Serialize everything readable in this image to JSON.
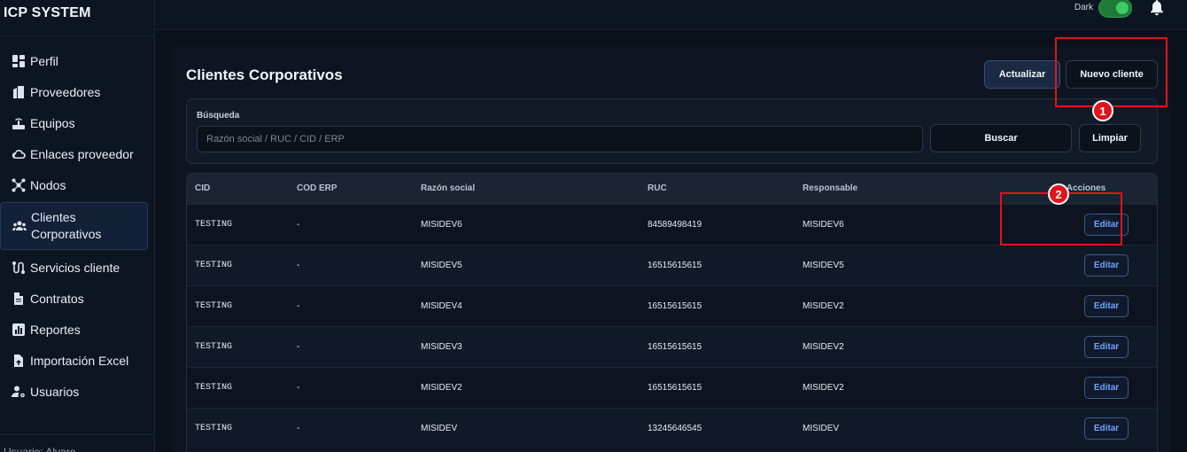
{
  "app": {
    "brand": "ICP SYSTEM"
  },
  "sidebar": {
    "items": [
      {
        "label": "Perfil",
        "icon": "dashboard-icon"
      },
      {
        "label": "Proveedores",
        "icon": "building-icon"
      },
      {
        "label": "Equipos",
        "icon": "router-icon"
      },
      {
        "label": "Enlaces proveedor",
        "icon": "cloud-icon"
      },
      {
        "label": "Nodos",
        "icon": "network-icon"
      },
      {
        "label": "Clientes Corporativos",
        "icon": "users-icon"
      },
      {
        "label": "Servicios cliente",
        "icon": "route-icon"
      },
      {
        "label": "Contratos",
        "icon": "file-icon"
      },
      {
        "label": "Reportes",
        "icon": "chart-icon"
      },
      {
        "label": "Importación Excel",
        "icon": "file-upload-icon"
      },
      {
        "label": "Usuarios",
        "icon": "user-gear-icon"
      }
    ],
    "footer": "Usuario: Alvaro"
  },
  "topbar": {
    "theme_label": "Dark",
    "dark_on": true
  },
  "page": {
    "title": "Clientes Corporativos",
    "update_label": "Actualizar",
    "new_label": "Nuevo cliente"
  },
  "search": {
    "label": "Búsqueda",
    "placeholder": "Razón social / RUC / CID / ERP",
    "value": "",
    "search_label": "Buscar",
    "clear_label": "Limpiar"
  },
  "table": {
    "headers": [
      "CID",
      "COD ERP",
      "Razón social",
      "RUC",
      "Responsable",
      "Acciones"
    ],
    "edit_label": "Editar",
    "rows": [
      {
        "cid": "TESTING",
        "erp": "-",
        "razon": "MISIDEV6",
        "ruc": "84589498419",
        "resp": "MISIDEV6"
      },
      {
        "cid": "TESTING",
        "erp": "-",
        "razon": "MISIDEV5",
        "ruc": "16515615615",
        "resp": "MISIDEV5"
      },
      {
        "cid": "TESTING",
        "erp": "-",
        "razon": "MISIDEV4",
        "ruc": "16515615615",
        "resp": "MISIDEV2"
      },
      {
        "cid": "TESTING",
        "erp": "-",
        "razon": "MISIDEV3",
        "ruc": "16515615615",
        "resp": "MISIDEV2"
      },
      {
        "cid": "TESTING",
        "erp": "-",
        "razon": "MISIDEV2",
        "ruc": "16515615615",
        "resp": "MISIDEV2"
      },
      {
        "cid": "TESTING",
        "erp": "-",
        "razon": "MISIDEV",
        "ruc": "13245646545",
        "resp": "MISIDEV"
      }
    ]
  },
  "annotations": {
    "badge_1": "1",
    "badge_2": "2",
    "color": "#e0141b"
  }
}
